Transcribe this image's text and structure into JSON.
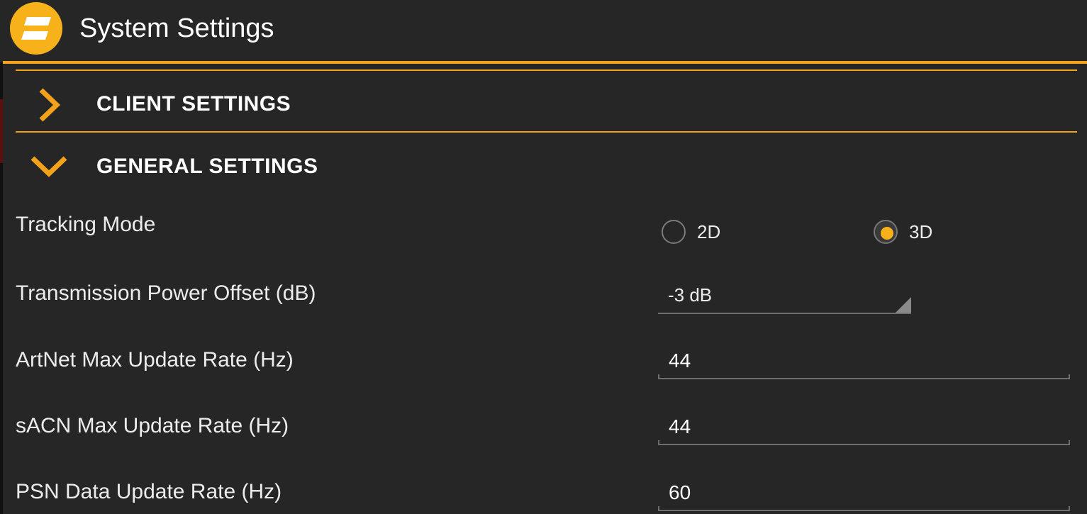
{
  "app": {
    "title": "System Settings",
    "logo_icon": "stacked-bars-logo",
    "accent_color": "#f5a21b"
  },
  "sections": [
    {
      "label": "CLIENT SETTINGS",
      "expanded": false,
      "icon": "chevron-right-icon"
    },
    {
      "label": "GENERAL SETTINGS",
      "expanded": true,
      "icon": "chevron-down-icon"
    }
  ],
  "general": {
    "tracking_mode": {
      "label": "Tracking Mode",
      "options": [
        {
          "label": "2D",
          "selected": false
        },
        {
          "label": "3D",
          "selected": true
        }
      ]
    },
    "tx_power": {
      "label": "Transmission Power Offset (dB)",
      "value": "-3 dB"
    },
    "artnet": {
      "label": "ArtNet Max Update Rate (Hz)",
      "value": "44"
    },
    "sacn": {
      "label": "sACN Max Update Rate (Hz)",
      "value": "44"
    },
    "psn": {
      "label": "PSN Data Update Rate (Hz)",
      "value": "60"
    }
  }
}
